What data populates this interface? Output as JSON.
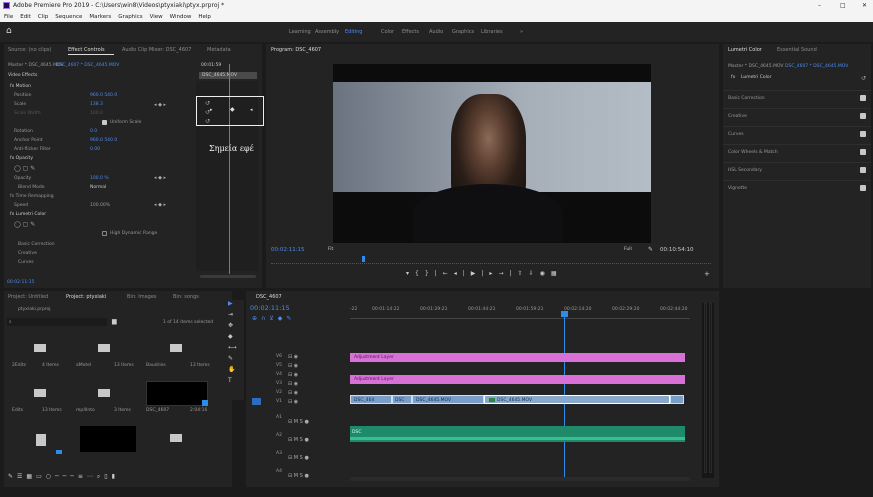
{
  "window": {
    "title": "Adobe Premiere Pro 2019 - C:\\Users\\win8\\Videos\\ptyxiaki\\ptyx.prproj *",
    "min": "–",
    "restore": "□",
    "close": "✕"
  },
  "menu": [
    "File",
    "Edit",
    "Clip",
    "Sequence",
    "Markers",
    "Graphics",
    "View",
    "Window",
    "Help"
  ],
  "workspaces": [
    "Learning",
    "Assembly",
    "Editing",
    "Color",
    "Effects",
    "Audio",
    "Graphics",
    "Libraries"
  ],
  "workspace_more": "»",
  "effect_controls": {
    "tabs": [
      "Source: (no clips)",
      "Effect Controls",
      "Audio Clip Mixer: DSC_4607",
      "Metadata"
    ],
    "master": "Master * DSC_4645.MOV",
    "clip": "DSC_4607 * DSC_4645.MOV",
    "timecode_start": "00:01:59",
    "clip_label": "DSC_4645.MOV",
    "section": "Video Effects",
    "rows": [
      {
        "name": "fx Motion",
        "value": ""
      },
      {
        "name": "Position",
        "value": "960.0   540.0"
      },
      {
        "name": "Scale",
        "value": "138.3"
      },
      {
        "name": "Scale Width",
        "value": "100.0"
      },
      {
        "name": "",
        "value": "Uniform Scale"
      },
      {
        "name": "Rotation",
        "value": "0.0"
      },
      {
        "name": "Anchor Point",
        "value": "960.0   540.0"
      },
      {
        "name": "Anti-flicker Filter",
        "value": "0.00"
      },
      {
        "name": "fx Opacity",
        "value": ""
      },
      {
        "name": "",
        "value": ""
      },
      {
        "name": "Opacity",
        "value": "100.0 %"
      },
      {
        "name": "Blend Mode",
        "value": "Normal"
      },
      {
        "name": "fx Time Remapping",
        "value": ""
      },
      {
        "name": "Speed",
        "value": "100.00%"
      },
      {
        "name": "fx Lumetri Color",
        "value": ""
      },
      {
        "name": "",
        "value": ""
      },
      {
        "name": "",
        "value": "High Dynamic Range"
      },
      {
        "name": "Basic Correction",
        "value": ""
      },
      {
        "name": "Creative",
        "value": ""
      },
      {
        "name": "Curves",
        "value": ""
      }
    ],
    "annotation": "Σημεία εφέ",
    "footer_timecode": "00:02:11:15"
  },
  "program": {
    "tab": "Program: DSC_4607",
    "timecode": "00:02:11:15",
    "fit": "Fit",
    "resolution": "Full",
    "duration": "00:10:54:10"
  },
  "lumetri": {
    "tabs": [
      "Lumetri Color",
      "Essential Sound"
    ],
    "master": "Master * DSC_4645.MOV",
    "clip": "DSC_4607 * DSC_4645.MOV",
    "fx": "fx",
    "effect": "Lumetri Color",
    "sections": [
      "Basic Correction",
      "Creative",
      "Curves",
      "Color Wheels & Match",
      "HSL Secondary",
      "Vignette"
    ]
  },
  "project": {
    "tabs": [
      "Project: Untitled",
      "Project: ptyxiaki",
      "Bin: Images",
      "Bin: songs"
    ],
    "name": "ptyxiaki.prproj",
    "selected": "1 of 14 items selected",
    "items": [
      {
        "name": "2Edits",
        "meta": "4 Items"
      },
      {
        "name": "aMotel",
        "meta": "13 Items"
      },
      {
        "name": "Baudries",
        "meta": "13 Items"
      },
      {
        "name": "Edits",
        "meta": "13 Items"
      },
      {
        "name": "mp4Into",
        "meta": "3 Items"
      },
      {
        "name": "DSC_4607",
        "meta": "2:04:16"
      },
      {
        "name": "",
        "meta": ""
      },
      {
        "name": "",
        "meta": ""
      },
      {
        "name": "",
        "meta": ""
      }
    ]
  },
  "timeline": {
    "tab": "DSC_4607",
    "timecode": "00:02:11:15",
    "ruler": [
      "-22",
      "00:01:14:22",
      "00:01:29:21",
      "00:01:44:21",
      "00:01:59:21",
      "00:02:14:20",
      "00:02:29:20",
      "00:02:44:20"
    ],
    "tracks": [
      "V6",
      "V5",
      "V4",
      "V3",
      "V2",
      "V1",
      "A1",
      "A2",
      "A3",
      "A4"
    ],
    "clips": {
      "v5": "Adjustment Layer",
      "v3": "Adjustment Layer",
      "v1a": "DSC_464",
      "v1b": "DSC",
      "v1c": "DSC_4645.MOV",
      "v1d": "DSC_4645.MOV",
      "a1": "DSC"
    },
    "tools": [
      "▶",
      "⇥",
      "✥",
      "◆",
      "⟷",
      "✎",
      "✋",
      "T"
    ]
  },
  "colors": {
    "accent": "#2d8ceb",
    "pink": "#d870d8",
    "blue_clip": "#7a9ec8",
    "green_audio": "#1e8a6a"
  }
}
